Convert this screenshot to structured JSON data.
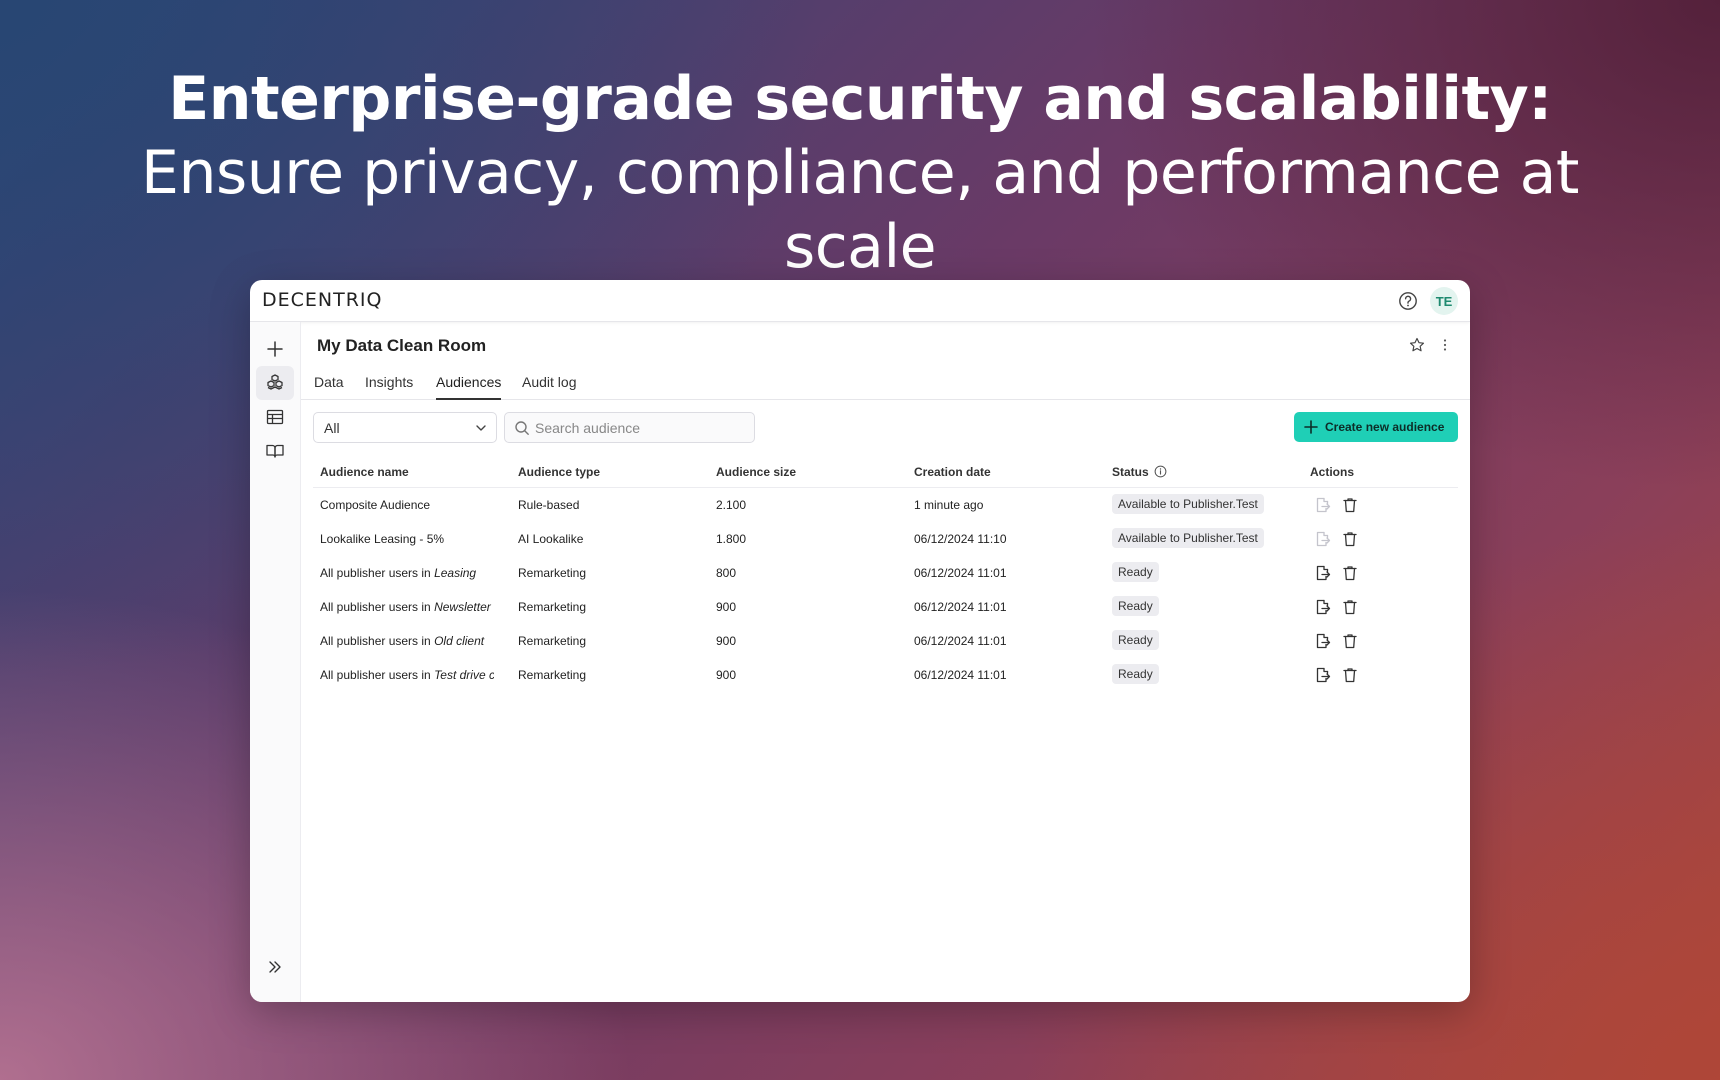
{
  "headline": {
    "bold": "Enterprise-grade security and scalability:",
    "rest": " Ensure privacy, compliance, and performance at scale"
  },
  "app": {
    "logo": "DECENTRIQ",
    "avatar_initials": "TE",
    "room_title": "My Data Clean Room",
    "tabs": [
      "Data",
      "Insights",
      "Audiences",
      "Audit log"
    ],
    "active_tab": "Audiences"
  },
  "toolbar": {
    "filter_value": "All",
    "search_placeholder": "Search audience",
    "create_label": "Create new audience"
  },
  "table": {
    "columns": [
      "Audience name",
      "Audience type",
      "Audience size",
      "Creation date",
      "Status",
      "Actions"
    ],
    "rows": [
      {
        "name_prefix": "Composite Audience",
        "name_italic": "",
        "type": "Rule-based",
        "size": "2.100",
        "date": "1 minute ago",
        "status": "Available to Publisher.Test",
        "export_enabled": false
      },
      {
        "name_prefix": "Lookalike Leasing - 5%",
        "name_italic": "",
        "type": "AI Lookalike",
        "size": "1.800",
        "date": "06/12/2024 11:10",
        "status": "Available to Publisher.Test",
        "export_enabled": false
      },
      {
        "name_prefix": "All publisher users in ",
        "name_italic": "Leasing",
        "type": "Remarketing",
        "size": "800",
        "date": "06/12/2024 11:01",
        "status": "Ready",
        "export_enabled": true
      },
      {
        "name_prefix": "All publisher users in ",
        "name_italic": "Newsletter s",
        "type": "Remarketing",
        "size": "900",
        "date": "06/12/2024 11:01",
        "status": "Ready",
        "export_enabled": true
      },
      {
        "name_prefix": "All publisher users in ",
        "name_italic": "Old client",
        "type": "Remarketing",
        "size": "900",
        "date": "06/12/2024 11:01",
        "status": "Ready",
        "export_enabled": true
      },
      {
        "name_prefix": "All publisher users in ",
        "name_italic": "Test drive cc",
        "type": "Remarketing",
        "size": "900",
        "date": "06/12/2024 11:01",
        "status": "Ready",
        "export_enabled": true
      }
    ]
  },
  "colors": {
    "accent": "#1fcfb6",
    "avatar_bg": "#e3f4ef",
    "avatar_fg": "#1f8a70"
  }
}
